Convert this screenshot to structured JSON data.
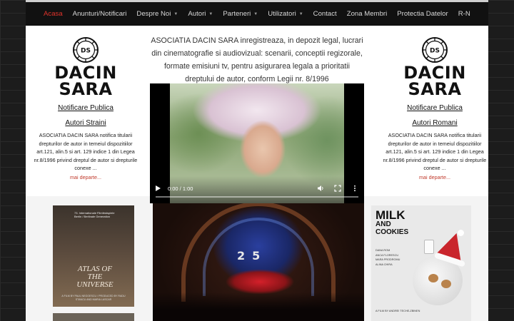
{
  "nav": {
    "items": [
      {
        "label": "Acasa",
        "active": true,
        "dropdown": false
      },
      {
        "label": "Anunturi/Notificari",
        "active": false,
        "dropdown": false
      },
      {
        "label": "Despre Noi",
        "active": false,
        "dropdown": true
      },
      {
        "label": "Autori",
        "active": false,
        "dropdown": true
      },
      {
        "label": "Parteneri",
        "active": false,
        "dropdown": true
      },
      {
        "label": "Utilizatori",
        "active": false,
        "dropdown": true
      },
      {
        "label": "Contact",
        "active": false,
        "dropdown": false
      },
      {
        "label": "Zona Membri",
        "active": false,
        "dropdown": false
      },
      {
        "label": "Protectia Datelor",
        "active": false,
        "dropdown": false
      },
      {
        "label": "R-N",
        "active": false,
        "dropdown": false
      }
    ]
  },
  "logo": {
    "initials": "DS",
    "line1": "DACIN",
    "line2": "SARA"
  },
  "left_column": {
    "link1": "Notificare Publica",
    "link2": "Autori Straini",
    "text": "ASOCIATIA DACIN SARA notifica titularii drepturilor de autor in temeiul dispozitiilor art.121, alin.5 si art. 129 indice 1 din Legea nr.8/1996 privind dreptul de autor si drepturile conexe ...",
    "more": "mai departe..."
  },
  "right_column": {
    "link1": "Notificare Publica",
    "link2": "Autori Romani",
    "text": "ASOCIATIA DACIN SARA notifica titularii drepturilor de autor in temeiul dispozitiilor art.121, alin.5 si art. 129 indice 1 din Legea nr.8/1996 privind dreptul de autor si drepturile conexe ...",
    "more": "mai departe..."
  },
  "intro": {
    "text": "ASOCIATIA DACIN SARA inregistreaza, in depozit legal, lucrari din cinematografie si audiovizual: scenarii, conceptii regizorale, formate emisiuni tv, pentru asigurarea legala a prioritatii dreptului de autor, conform Legii nr. 8/1996"
  },
  "video": {
    "time": "0:00 / 1:00",
    "progress": 0
  },
  "posters": {
    "atlas": {
      "festival": "73. Internationale Filmfestspiele Berlin / Berlinale Generation",
      "title": "ATLAS OF THE UNIVERSE",
      "credit": "A FILM BY PAUL NEGOESCU / PRODUCED BY RADU STANCU AND MARIA LASCAR"
    },
    "theater": {
      "number": "25"
    },
    "milk": {
      "title1": "MILK",
      "title2": "AND",
      "title3": "COOKIES",
      "cast": [
        "DANA ROM",
        "ANCA FLORESCU",
        "MARA PRODROMU",
        "ALINA CHIRA"
      ],
      "directed": "A FILM BY ANDREI TECHE-ZBINEN"
    }
  },
  "colors": {
    "active_nav": "#e0332b",
    "more_link": "#c0392b",
    "nav_bg": "#111111"
  }
}
